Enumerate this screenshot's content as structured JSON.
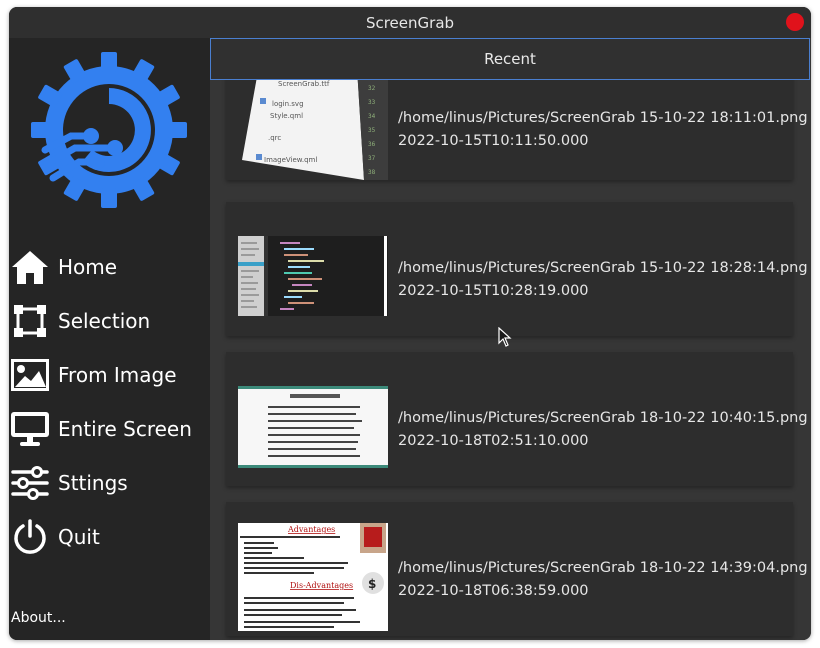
{
  "window": {
    "title": "ScreenGrab"
  },
  "sidebar": {
    "items": [
      {
        "label": "Home",
        "icon": "home-icon"
      },
      {
        "label": "Selection",
        "icon": "selection-icon"
      },
      {
        "label": "From Image",
        "icon": "image-icon"
      },
      {
        "label": "Entire Screen",
        "icon": "monitor-icon"
      },
      {
        "label": "Sttings",
        "icon": "sliders-icon"
      },
      {
        "label": "Quit",
        "icon": "power-icon"
      }
    ],
    "about": "About..."
  },
  "main": {
    "tab": "Recent",
    "items": [
      {
        "path": "/home/linus/Pictures/ScreenGrab 15-10-22 18:11:01.png",
        "timestamp": "2022-10-15T10:11:50.000"
      },
      {
        "path": "/home/linus/Pictures/ScreenGrab 15-10-22 18:28:14.png",
        "timestamp": "2022-10-15T10:28:19.000"
      },
      {
        "path": "/home/linus/Pictures/ScreenGrab 18-10-22 10:40:15.png",
        "timestamp": "2022-10-18T02:51:10.000"
      },
      {
        "path": "/home/linus/Pictures/ScreenGrab 18-10-22 14:39:04.png",
        "timestamp": "2022-10-18T06:38:59.000"
      }
    ],
    "thumb4": {
      "title1": "Advantages",
      "title2": "Dis-Advantages"
    }
  },
  "colors": {
    "accent": "#3380f0",
    "close": "#e0121b",
    "tab_border": "#4a7fd0"
  }
}
